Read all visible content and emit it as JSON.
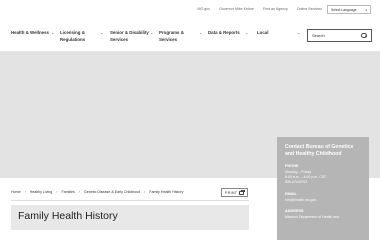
{
  "utility": {
    "links": [
      "MO.gov",
      "Governor Mike Kehoe",
      "Find an Agency",
      "Online Services"
    ],
    "language": "Select Language"
  },
  "nav": {
    "items": [
      {
        "line1": "Health & Wellness",
        "line2": ""
      },
      {
        "line1": "Licensing &",
        "line2": "Regulations"
      },
      {
        "line1": "Senior & Disability",
        "line2": "Services"
      },
      {
        "line1": "Programs &",
        "line2": "Services"
      },
      {
        "line1": "Data & Reports",
        "line2": ""
      },
      {
        "line1": "Local",
        "line2": ""
      }
    ],
    "search_placeholder": "Search"
  },
  "breadcrumb": [
    "Home",
    "Healthy Living",
    "Families",
    "Genetic Disease & Early Childhood",
    "Family Health History"
  ],
  "print_label": "PRINT",
  "page_title": "Family Health History",
  "contact": {
    "title": "Contact Bureau of Genetics and Healthy Childhood",
    "phone_label": "PHONE",
    "phone_lines": [
      "Monday – Friday",
      "8:00 a.m. – 4:00 p.m. CST",
      "800-474-6743"
    ],
    "email_label": "EMAIL",
    "email": "info@health.mo.gov",
    "address_label": "ADDRESS",
    "address_lines": [
      "Missouri Department of Health and"
    ]
  },
  "colors": {
    "hero": "#e3e3e3",
    "contact_card": "#b5b5b5",
    "title_banner": "#e8e8e8"
  }
}
